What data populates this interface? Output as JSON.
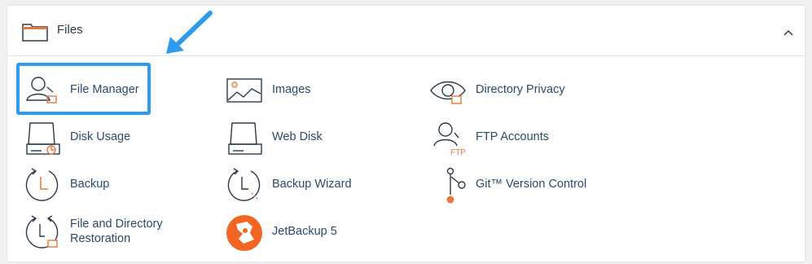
{
  "section": {
    "title": "Files",
    "items": [
      {
        "label": "File Manager",
        "icon": "file-manager-icon"
      },
      {
        "label": "Images",
        "icon": "images-icon"
      },
      {
        "label": "Directory Privacy",
        "icon": "directory-privacy-icon"
      },
      {
        "label": "Disk Usage",
        "icon": "disk-usage-icon"
      },
      {
        "label": "Web Disk",
        "icon": "web-disk-icon"
      },
      {
        "label": "FTP Accounts",
        "icon": "ftp-accounts-icon"
      },
      {
        "label": "Backup",
        "icon": "backup-icon"
      },
      {
        "label": "Backup Wizard",
        "icon": "backup-wizard-icon"
      },
      {
        "label": "Git™ Version Control",
        "icon": "git-icon"
      },
      {
        "label": "File and Directory",
        "label2": "Restoration",
        "icon": "restoration-icon"
      },
      {
        "label": "JetBackup 5",
        "icon": "jetbackup-icon"
      }
    ],
    "ftp_icon_text": "FTP"
  },
  "colors": {
    "accent_orange": "#e8793c",
    "highlight_blue": "#2f9bef",
    "label_blue": "#2a4a6e",
    "icon_dark": "#293a4a",
    "jetbackup_orange": "#f26522"
  }
}
